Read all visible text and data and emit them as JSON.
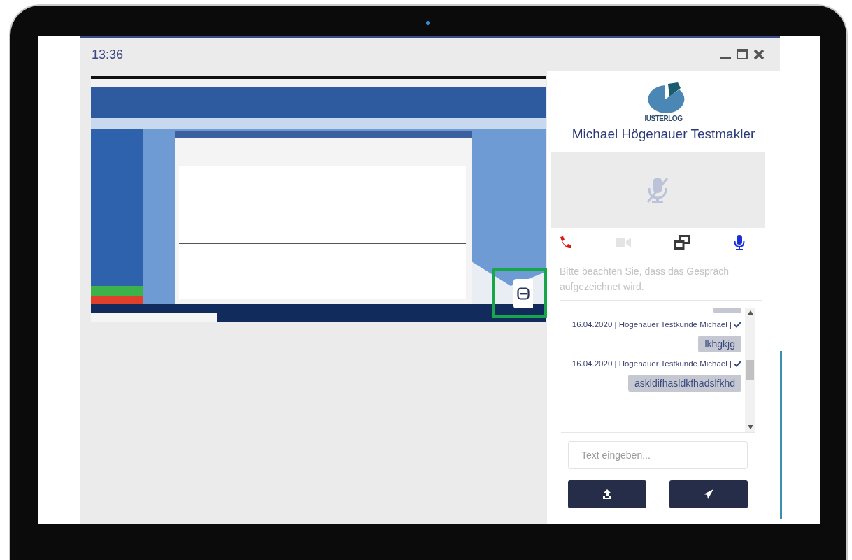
{
  "window": {
    "time": "13:36"
  },
  "contact": {
    "logo_text": "IUSTERLOG",
    "name": "Michael Högenauer Testmakler"
  },
  "call_controls": [
    {
      "kind": "hangup",
      "disabled": false
    },
    {
      "kind": "video",
      "disabled": true
    },
    {
      "kind": "screen",
      "disabled": false
    },
    {
      "kind": "mic",
      "disabled": false
    }
  ],
  "notice": "Bitte beachten Sie, dass das Gespräch aufgezeichnet wird.",
  "chat": [
    {
      "kind": "stub"
    },
    {
      "kind": "meta",
      "text": "16.04.2020 | Högenauer Testkunde Michael |"
    },
    {
      "kind": "bubble",
      "text": "lkhgkjg"
    },
    {
      "kind": "meta",
      "text": "16.04.2020 | Högenauer Testkunde Michael |"
    },
    {
      "kind": "bubble",
      "text": "askldifhasldkfhadslfkhd"
    }
  ],
  "composer": {
    "placeholder": "Text eingeben..."
  }
}
